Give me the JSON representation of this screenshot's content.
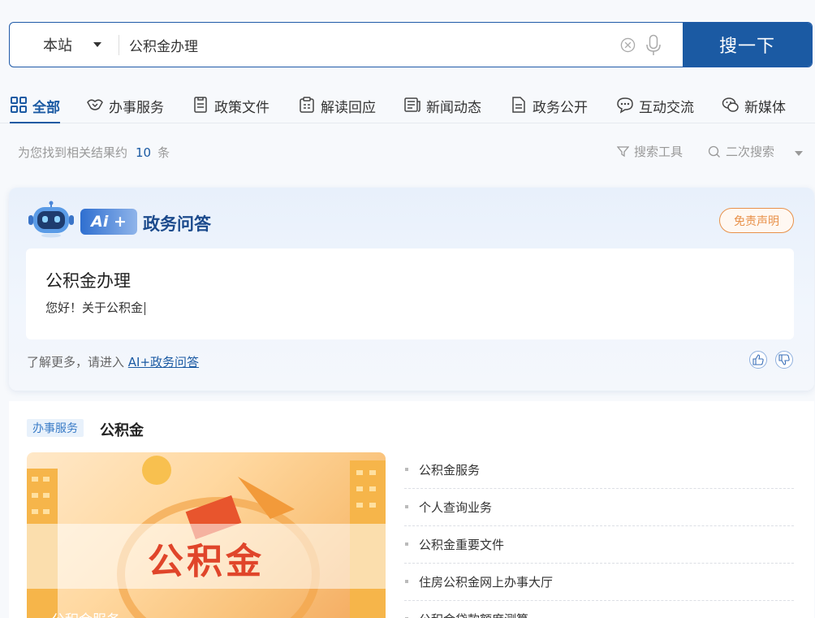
{
  "search": {
    "scope_label": "本站",
    "query": "公积金办理",
    "button_label": "搜一下"
  },
  "tabs": [
    {
      "label": "全部",
      "icon": "grid-icon",
      "active": true
    },
    {
      "label": "办事服务",
      "icon": "handshake-icon"
    },
    {
      "label": "政策文件",
      "icon": "document-icon"
    },
    {
      "label": "解读回应",
      "icon": "clipboard-icon"
    },
    {
      "label": "新闻动态",
      "icon": "newspaper-icon"
    },
    {
      "label": "政务公开",
      "icon": "file-icon"
    },
    {
      "label": "互动交流",
      "icon": "chat-icon"
    },
    {
      "label": "新媒体",
      "icon": "wechat-icon"
    }
  ],
  "results": {
    "prefix": "为您找到相关结果约",
    "count": "10",
    "suffix": "条",
    "search_tools_label": "搜索工具",
    "secondary_search_label": "二次搜索"
  },
  "ai_qa": {
    "badge": "Ai +",
    "title": "政务问答",
    "disclaimer": "免责声明",
    "question": "公积金办理",
    "answer": "您好！关于公积金",
    "learn_more_prefix": "了解更多，请进入",
    "learn_more_link": "AI+政务问答"
  },
  "service": {
    "tag": "办事服务",
    "title": "公积金",
    "image_text": "公积金",
    "image_caption": "公积金服务",
    "items": [
      "公积金服务",
      "个人查询业务",
      "公积金重要文件",
      "住房公积金网上办事大厅",
      "公积金贷款额度测算"
    ]
  },
  "colors": {
    "primary": "#1b5aa3",
    "disclaimer": "#e8914a",
    "image_text": "#e0452a"
  }
}
